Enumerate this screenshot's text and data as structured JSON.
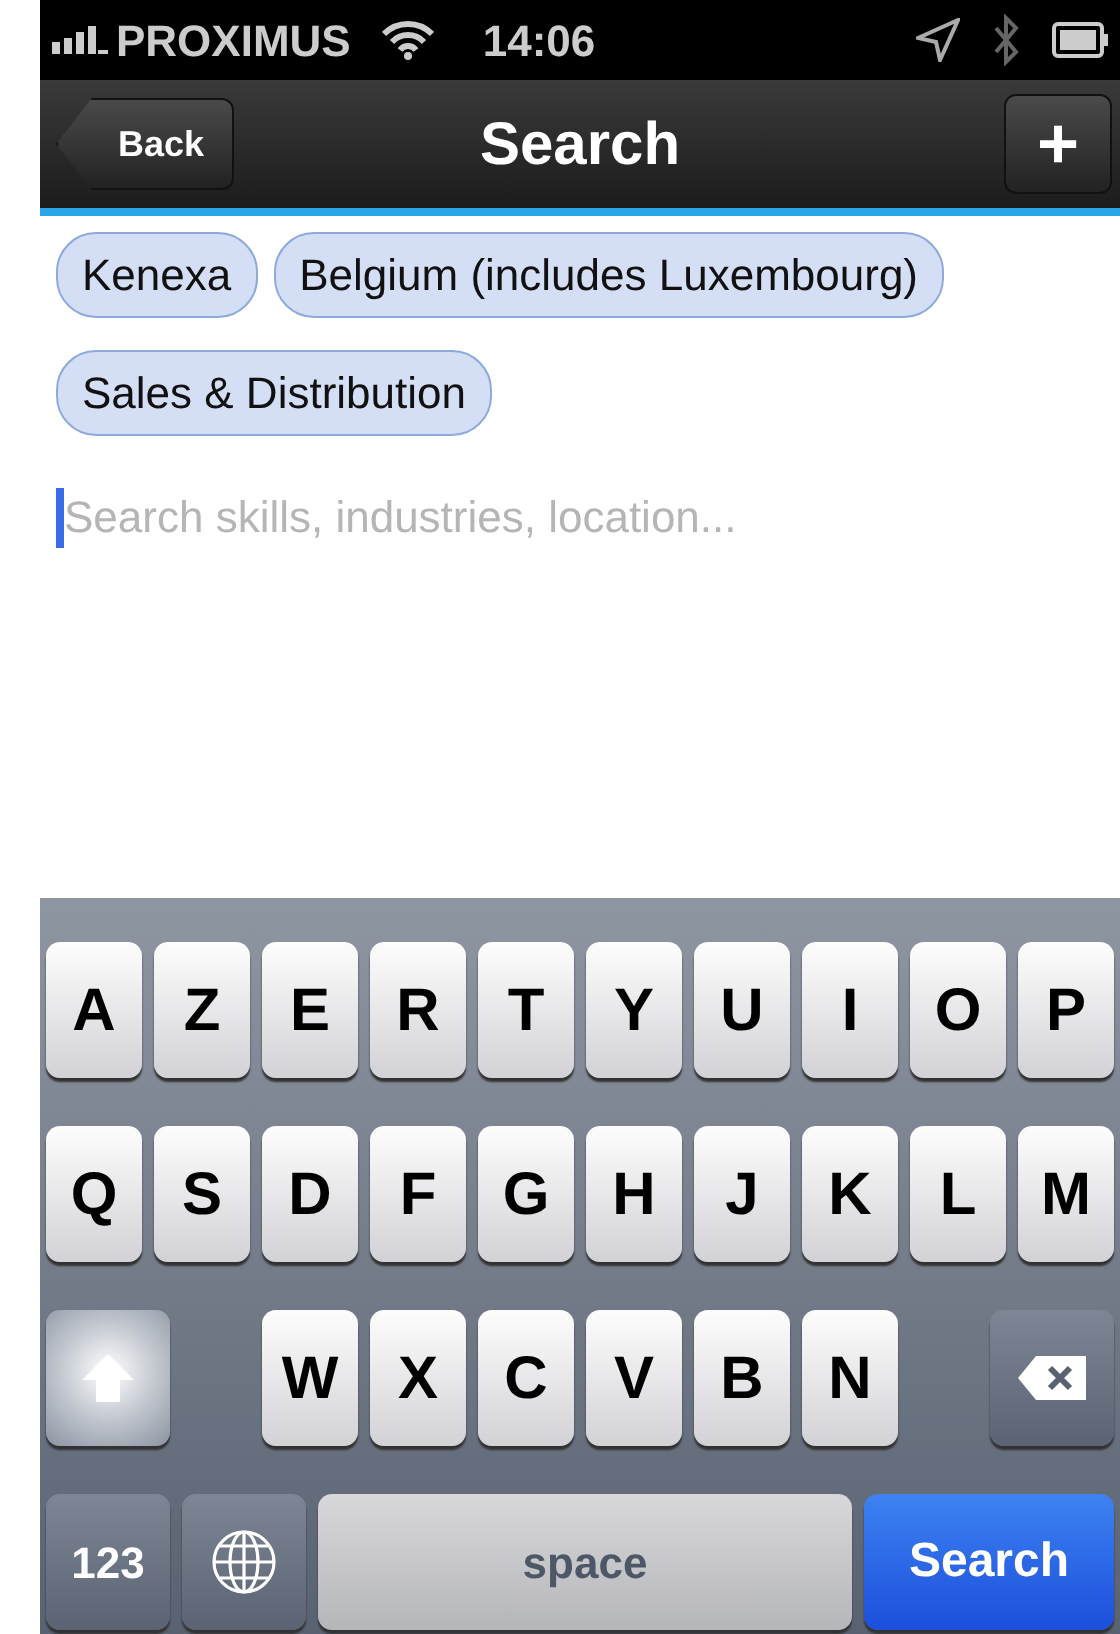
{
  "status_bar": {
    "carrier": "PROXIMUS",
    "time": "14:06"
  },
  "nav_bar": {
    "back": "Back",
    "title": "Search",
    "add": "+"
  },
  "tags": [
    {
      "label": "Kenexa"
    },
    {
      "label": "Belgium (includes Luxembourg)"
    },
    {
      "label": "Sales & Distribution"
    }
  ],
  "search": {
    "placeholder": "Search skills, industries, location..."
  },
  "keyboard": {
    "rows": [
      {
        "keys": [
          {
            "kind": "letter",
            "label": "A"
          },
          {
            "kind": "letter",
            "label": "Z"
          },
          {
            "kind": "letter",
            "label": "E"
          },
          {
            "kind": "letter",
            "label": "R"
          },
          {
            "kind": "letter",
            "label": "T"
          },
          {
            "kind": "letter",
            "label": "Y"
          },
          {
            "kind": "letter",
            "label": "U"
          },
          {
            "kind": "letter",
            "label": "I"
          },
          {
            "kind": "letter",
            "label": "O"
          },
          {
            "kind": "letter",
            "label": "P"
          }
        ]
      },
      {
        "keys": [
          {
            "kind": "letter",
            "label": "Q"
          },
          {
            "kind": "letter",
            "label": "S"
          },
          {
            "kind": "letter",
            "label": "D"
          },
          {
            "kind": "letter",
            "label": "F"
          },
          {
            "kind": "letter",
            "label": "G"
          },
          {
            "kind": "letter",
            "label": "H"
          },
          {
            "kind": "letter",
            "label": "J"
          },
          {
            "kind": "letter",
            "label": "K"
          },
          {
            "kind": "letter",
            "label": "L"
          },
          {
            "kind": "letter",
            "label": "M"
          }
        ]
      },
      {
        "keys": [
          {
            "kind": "shift",
            "on": true
          },
          {
            "kind": "letter",
            "label": "W"
          },
          {
            "kind": "letter",
            "label": "X"
          },
          {
            "kind": "letter",
            "label": "C"
          },
          {
            "kind": "letter",
            "label": "V"
          },
          {
            "kind": "letter",
            "label": "B"
          },
          {
            "kind": "letter",
            "label": "N"
          },
          {
            "kind": "delete"
          }
        ]
      },
      {
        "keys": [
          {
            "kind": "numbers",
            "label": "123"
          },
          {
            "kind": "globe"
          },
          {
            "kind": "space",
            "label": "space"
          },
          {
            "kind": "search",
            "label": "Search"
          }
        ]
      }
    ]
  }
}
